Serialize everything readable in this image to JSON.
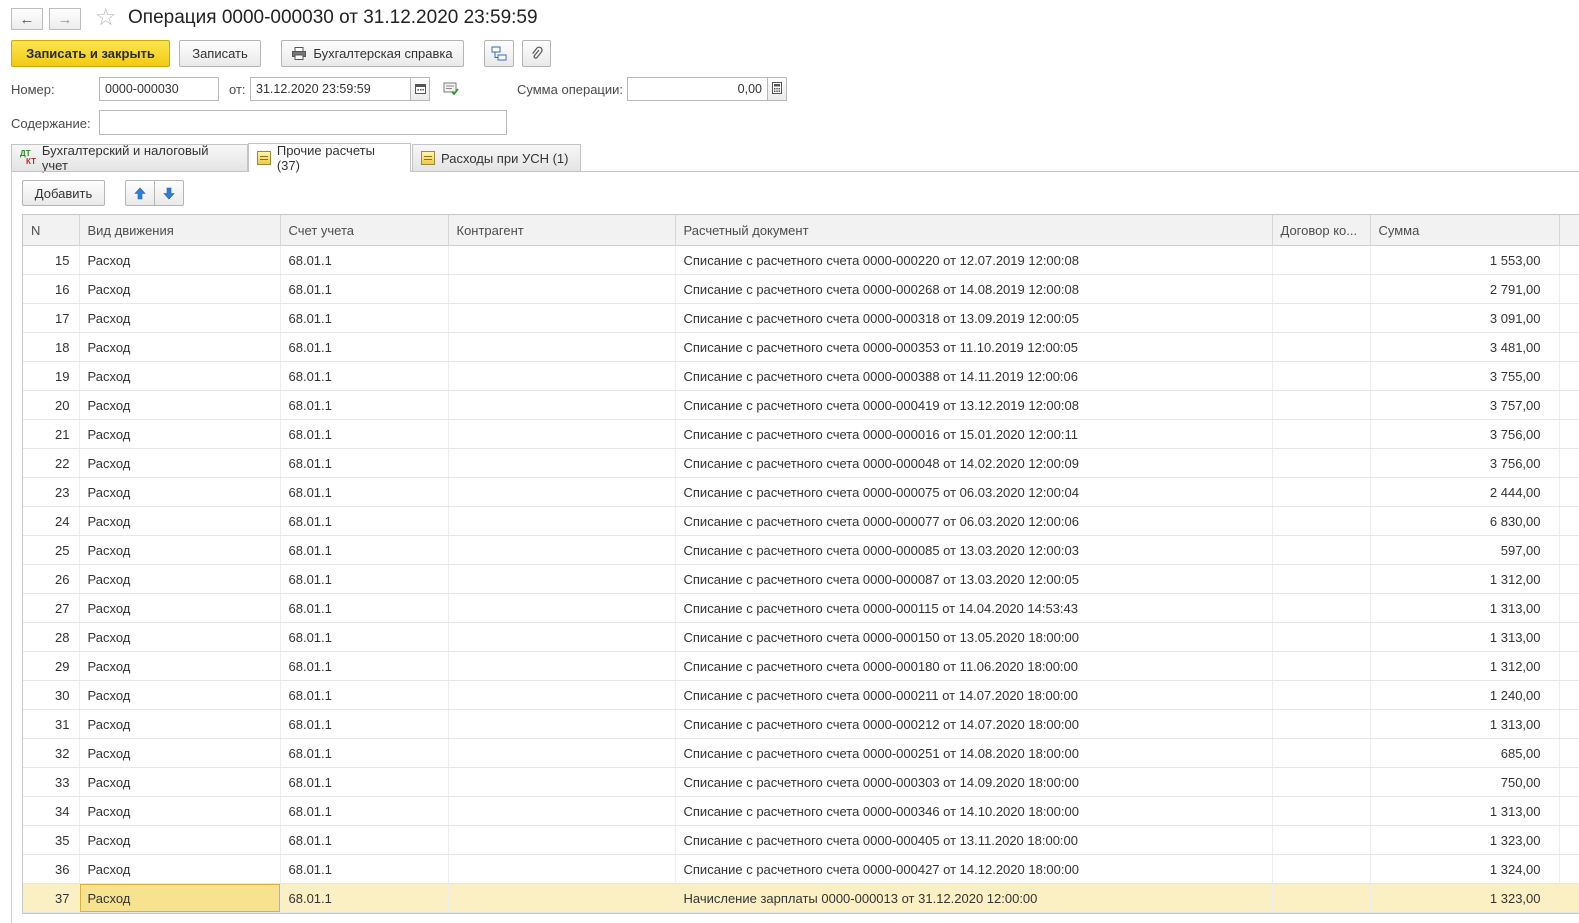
{
  "window": {
    "title": "Операция 0000-000030 от 31.12.2020 23:59:59"
  },
  "toolbar": {
    "save_close": "Записать и закрыть",
    "save": "Записать",
    "report": "Бухгалтерская справка"
  },
  "form": {
    "number_label": "Номер:",
    "number_value": "0000-000030",
    "date_label": "от:",
    "date_value": "31.12.2020 23:59:59",
    "sum_label": "Сумма операции:",
    "sum_value": "0,00",
    "content_label": "Содержание:",
    "content_value": ""
  },
  "tabs": [
    {
      "label": "Бухгалтерский и налоговый учет",
      "active": false
    },
    {
      "label": "Прочие расчеты (37)",
      "active": true
    },
    {
      "label": "Расходы при УСН (1)",
      "active": false
    }
  ],
  "tab_toolbar": {
    "add": "Добавить"
  },
  "table": {
    "columns": [
      "N",
      "Вид движения",
      "Счет учета",
      "Контрагент",
      "Расчетный документ",
      "Договор ко...",
      "Сумма"
    ],
    "rows": [
      [
        "15",
        "Расход",
        "68.01.1",
        "",
        "Списание с расчетного счета 0000-000220 от 12.07.2019 12:00:08",
        "",
        "1 553,00"
      ],
      [
        "16",
        "Расход",
        "68.01.1",
        "",
        "Списание с расчетного счета 0000-000268 от 14.08.2019 12:00:08",
        "",
        "2 791,00"
      ],
      [
        "17",
        "Расход",
        "68.01.1",
        "",
        "Списание с расчетного счета 0000-000318 от 13.09.2019 12:00:05",
        "",
        "3 091,00"
      ],
      [
        "18",
        "Расход",
        "68.01.1",
        "",
        "Списание с расчетного счета 0000-000353 от 11.10.2019 12:00:05",
        "",
        "3 481,00"
      ],
      [
        "19",
        "Расход",
        "68.01.1",
        "",
        "Списание с расчетного счета 0000-000388 от 14.11.2019 12:00:06",
        "",
        "3 755,00"
      ],
      [
        "20",
        "Расход",
        "68.01.1",
        "",
        "Списание с расчетного счета 0000-000419 от 13.12.2019 12:00:08",
        "",
        "3 757,00"
      ],
      [
        "21",
        "Расход",
        "68.01.1",
        "",
        "Списание с расчетного счета 0000-000016 от 15.01.2020 12:00:11",
        "",
        "3 756,00"
      ],
      [
        "22",
        "Расход",
        "68.01.1",
        "",
        "Списание с расчетного счета 0000-000048 от 14.02.2020 12:00:09",
        "",
        "3 756,00"
      ],
      [
        "23",
        "Расход",
        "68.01.1",
        "",
        "Списание с расчетного счета 0000-000075 от 06.03.2020 12:00:04",
        "",
        "2 444,00"
      ],
      [
        "24",
        "Расход",
        "68.01.1",
        "",
        "Списание с расчетного счета 0000-000077 от 06.03.2020 12:00:06",
        "",
        "6 830,00"
      ],
      [
        "25",
        "Расход",
        "68.01.1",
        "",
        "Списание с расчетного счета 0000-000085 от 13.03.2020 12:00:03",
        "",
        "597,00"
      ],
      [
        "26",
        "Расход",
        "68.01.1",
        "",
        "Списание с расчетного счета 0000-000087 от 13.03.2020 12:00:05",
        "",
        "1 312,00"
      ],
      [
        "27",
        "Расход",
        "68.01.1",
        "",
        "Списание с расчетного счета 0000-000115 от 14.04.2020 14:53:43",
        "",
        "1 313,00"
      ],
      [
        "28",
        "Расход",
        "68.01.1",
        "",
        "Списание с расчетного счета 0000-000150 от 13.05.2020 18:00:00",
        "",
        "1 313,00"
      ],
      [
        "29",
        "Расход",
        "68.01.1",
        "",
        "Списание с расчетного счета 0000-000180 от 11.06.2020 18:00:00",
        "",
        "1 312,00"
      ],
      [
        "30",
        "Расход",
        "68.01.1",
        "",
        "Списание с расчетного счета 0000-000211 от 14.07.2020 18:00:00",
        "",
        "1 240,00"
      ],
      [
        "31",
        "Расход",
        "68.01.1",
        "",
        "Списание с расчетного счета 0000-000212 от 14.07.2020 18:00:00",
        "",
        "1 313,00"
      ],
      [
        "32",
        "Расход",
        "68.01.1",
        "",
        "Списание с расчетного счета 0000-000251 от 14.08.2020 18:00:00",
        "",
        "685,00"
      ],
      [
        "33",
        "Расход",
        "68.01.1",
        "",
        "Списание с расчетного счета 0000-000303 от 14.09.2020 18:00:00",
        "",
        "750,00"
      ],
      [
        "34",
        "Расход",
        "68.01.1",
        "",
        "Списание с расчетного счета 0000-000346 от 14.10.2020 18:00:00",
        "",
        "1 313,00"
      ],
      [
        "35",
        "Расход",
        "68.01.1",
        "",
        "Списание с расчетного счета 0000-000405 от 13.11.2020 18:00:00",
        "",
        "1 323,00"
      ],
      [
        "36",
        "Расход",
        "68.01.1",
        "",
        "Списание с расчетного счета 0000-000427 от 14.12.2020 18:00:00",
        "",
        "1 324,00"
      ],
      [
        "37",
        "Расход",
        "68.01.1",
        "",
        "Начисление зарплаты 0000-000013 от 31.12.2020 12:00:00",
        "",
        "1 323,00"
      ]
    ],
    "selected_row": 22
  },
  "colors": {
    "accent_button": "#f5d327",
    "selected_row": "#fbf0c4",
    "arrow_blue": "#2f7fd8"
  },
  "icons": [
    "back-arrow-icon",
    "forward-arrow-icon",
    "favorite-star-icon",
    "printer-icon",
    "structure-icon",
    "paperclip-icon",
    "calendar-icon",
    "calculator-icon",
    "dt-kt-icon",
    "document-icon",
    "move-up-icon",
    "move-down-icon"
  ]
}
